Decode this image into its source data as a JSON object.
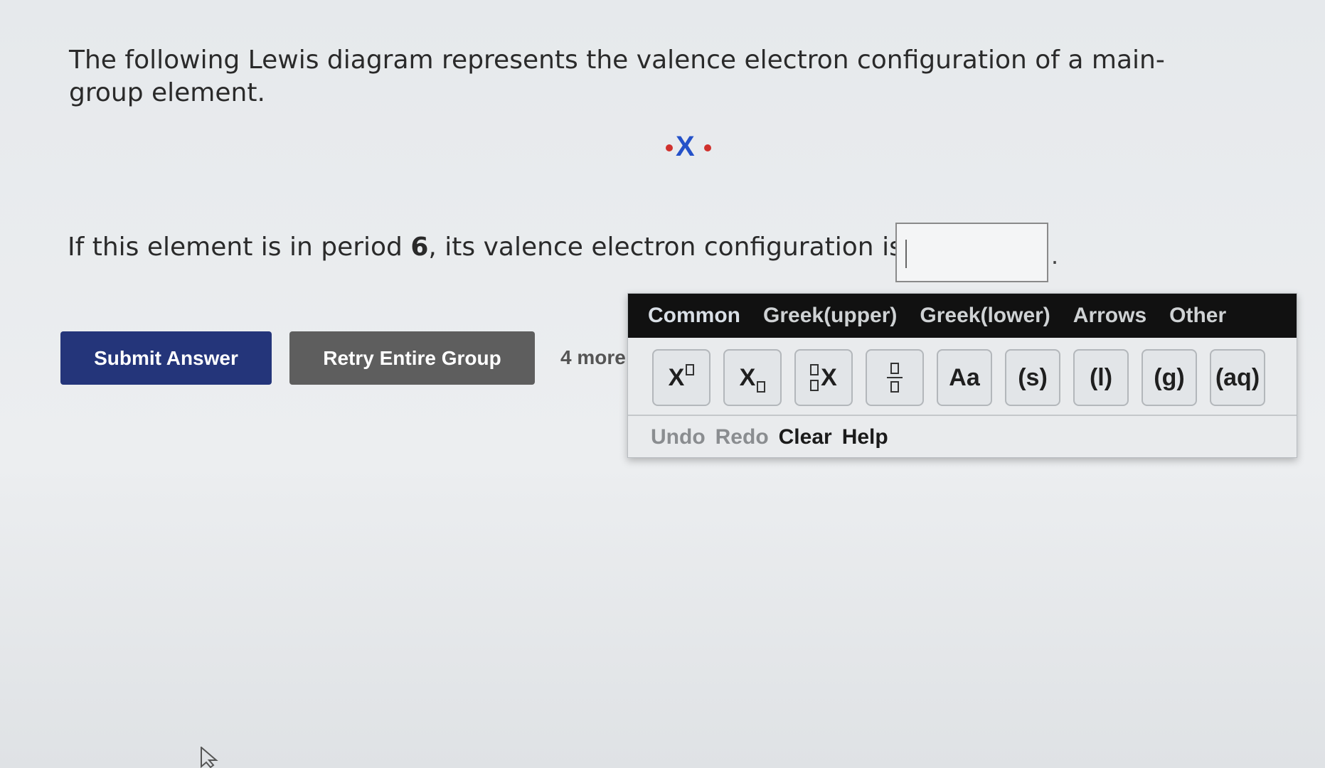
{
  "question": {
    "intro": "The following Lewis diagram represents the valence electron configuration of a main-group element.",
    "lewis_symbol": "X",
    "prompt_before": "If this element is in period ",
    "period_value": "6",
    "prompt_after": ", its valence electron configuration is",
    "answer_value": "",
    "trailing_punct": "."
  },
  "buttons": {
    "submit": "Submit Answer",
    "retry": "Retry Entire Group",
    "more": "4 more"
  },
  "palette": {
    "tabs": [
      "Common",
      "Greek(upper)",
      "Greek(lower)",
      "Arrows",
      "Other"
    ],
    "keys": {
      "superscript": "X",
      "subscript": "X",
      "preisotope": "X",
      "aa": "Aa",
      "solid": "(s)",
      "liquid": "(l)",
      "gas": "(g)",
      "aqueous": "(aq)"
    },
    "actions": {
      "undo": "Undo",
      "redo": "Redo",
      "clear": "Clear",
      "help": "Help"
    }
  },
  "colors": {
    "lewis_dot": "#d0312d",
    "lewis_symbol": "#2451c9",
    "submit_bg": "#24357a",
    "retry_bg": "#5e5e5e",
    "tabbar_bg": "#111111"
  }
}
